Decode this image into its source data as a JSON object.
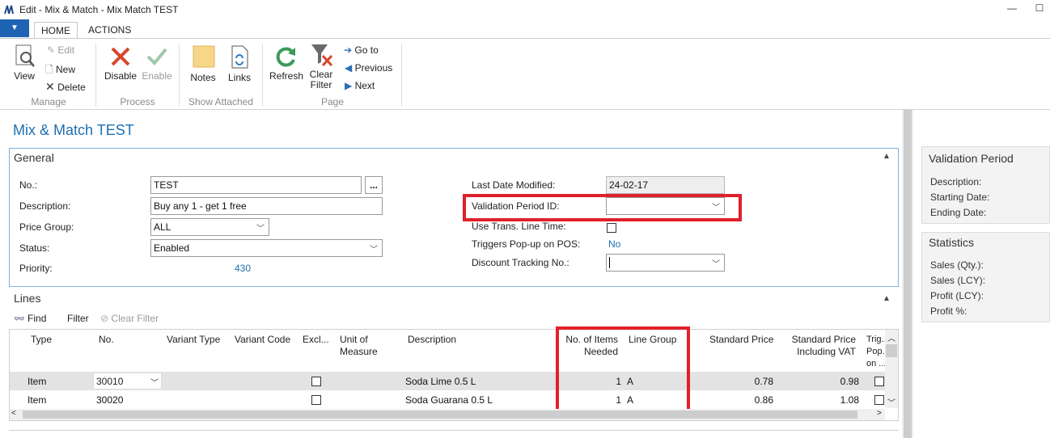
{
  "window": {
    "title": "Edit - Mix & Match - Mix  Match TEST",
    "minimize": "—",
    "maximize": "☐"
  },
  "ribbon": {
    "tabs": [
      {
        "label": "HOME"
      },
      {
        "label": "ACTIONS"
      }
    ],
    "manage": {
      "group": "Manage",
      "view": "View",
      "edit": "Edit",
      "new": "New",
      "delete": "Delete"
    },
    "process": {
      "group": "Process",
      "disable": "Disable",
      "enable": "Enable"
    },
    "show_attached": {
      "group": "Show Attached",
      "notes": "Notes",
      "links": "Links"
    },
    "page": {
      "group": "Page",
      "refresh": "Refresh",
      "clear_filter": "Clear\nFilter",
      "go_to": "Go to",
      "previous": "Previous",
      "next": "Next"
    }
  },
  "page_title": "Mix & Match TEST",
  "general": {
    "header": "General",
    "no": {
      "label": "No.:",
      "value": "TEST",
      "assist": "..."
    },
    "description": {
      "label": "Description:",
      "value": "Buy any 1 - get 1 free"
    },
    "price_group": {
      "label": "Price Group:",
      "value": "ALL"
    },
    "status": {
      "label": "Status:",
      "value": "Enabled"
    },
    "priority": {
      "label": "Priority:",
      "value": "430"
    },
    "last_date_modified": {
      "label": "Last Date Modified:",
      "value": "24-02-17"
    },
    "validation_period_id": {
      "label": "Validation Period ID:",
      "value": ""
    },
    "use_trans_line_time": {
      "label": "Use Trans. Line Time:",
      "checked": false
    },
    "triggers_popup": {
      "label": "Triggers Pop-up on POS:",
      "value": "No"
    },
    "discount_tracking": {
      "label": "Discount Tracking No.:",
      "value": ""
    }
  },
  "lines": {
    "header": "Lines",
    "toolbar": {
      "find": "Find",
      "filter": "Filter",
      "clear_filter": "Clear Filter"
    },
    "columns": {
      "type": "Type",
      "no": "No.",
      "variant_type": "Variant Type",
      "variant_code": "Variant Code",
      "excl": "Excl...",
      "uom1": "Unit of",
      "uom2": "Measure",
      "description": "Description",
      "items_needed1": "No. of Items",
      "items_needed2": "Needed",
      "line_group": "Line Group",
      "std_price": "Standard Price",
      "std_vat1": "Standard Price",
      "std_vat2": "Including VAT",
      "trig1": "Trig...",
      "trig2": "Pop...",
      "trig3": "on ..."
    },
    "rows": [
      {
        "type": "Item",
        "no": "30010",
        "description": "Soda Lime 0.5 L",
        "items_needed": "1",
        "line_group": "A",
        "std_price": "0.78",
        "std_vat": "0.98"
      },
      {
        "type": "Item",
        "no": "30020",
        "description": "Soda Guarana 0.5 L",
        "items_needed": "1",
        "line_group": "A",
        "std_price": "0.86",
        "std_vat": "1.08"
      }
    ]
  },
  "factboxes": {
    "validation": {
      "title": "Validation Period",
      "description": "Description:",
      "starting": "Starting Date:",
      "ending": "Ending Date:"
    },
    "statistics": {
      "title": "Statistics",
      "sales_qty": "Sales (Qty.):",
      "sales_lcy": "Sales (LCY):",
      "profit_lcy": "Profit (LCY):",
      "profit_pct": "Profit %:"
    }
  },
  "colors": {
    "accent": "#1e6fb0",
    "highlight": "#e0202a",
    "file_button": "#1f63b5"
  }
}
